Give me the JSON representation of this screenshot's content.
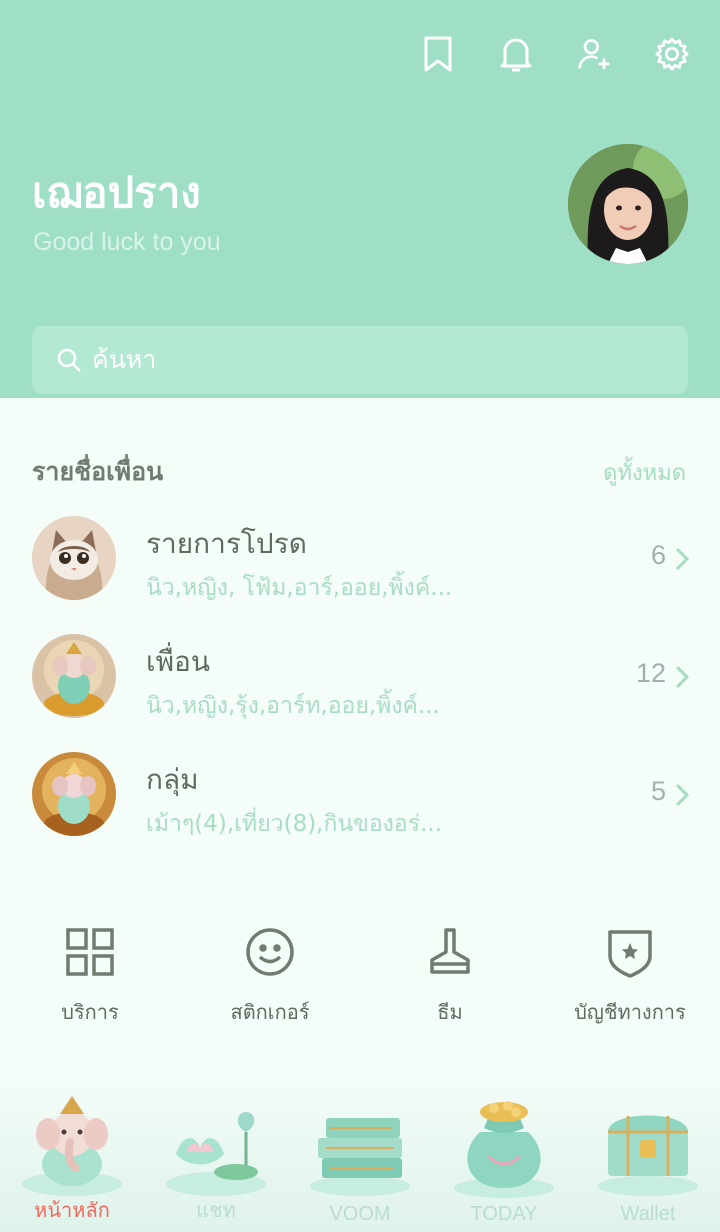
{
  "header": {
    "name": "เฌอปราง",
    "status": "Good luck to you",
    "bg_color": "#9fdfc5",
    "icons": [
      "bookmark-icon",
      "bell-icon",
      "add-friend-icon",
      "gear-icon"
    ]
  },
  "search": {
    "placeholder": "ค้นหา"
  },
  "friends": {
    "title": "รายชื่อเพื่อน",
    "see_all": "ดูทั้งหมด",
    "rows": [
      {
        "title": "รายการโปรด",
        "sub": "นิว,หญิง, โฟ้ม,อาร์,ออย,พิ้งค์...",
        "count": "6"
      },
      {
        "title": "เพื่อน",
        "sub": "นิว,หญิง,รุ้ง,อาร์ท,ออย,พิ้งค์...",
        "count": "12"
      },
      {
        "title": "กลุ่ม",
        "sub": "เม้าๆ(4),เที่ยว(8),กินของอร่...",
        "count": "5"
      }
    ]
  },
  "shortcuts": [
    {
      "label": "บริการ",
      "icon": "grid-icon"
    },
    {
      "label": "สติกเกอร์",
      "icon": "smiley-icon"
    },
    {
      "label": "ธีม",
      "icon": "brush-icon"
    },
    {
      "label": "บัญชีทางการ",
      "icon": "shield-star-icon"
    }
  ],
  "nav": [
    {
      "label": "หน้าหลัก",
      "icon": "ganesha-icon",
      "active": true
    },
    {
      "label": "แชท",
      "icon": "lotus-icon",
      "active": false
    },
    {
      "label": "VOOM",
      "icon": "books-icon",
      "active": false
    },
    {
      "label": "TODAY",
      "icon": "money-bag-icon",
      "active": false
    },
    {
      "label": "Wallet",
      "icon": "treasure-chest-icon",
      "active": false
    }
  ],
  "colors": {
    "accent_active": "#f06a5f",
    "text_muted": "#a9dcc6"
  }
}
